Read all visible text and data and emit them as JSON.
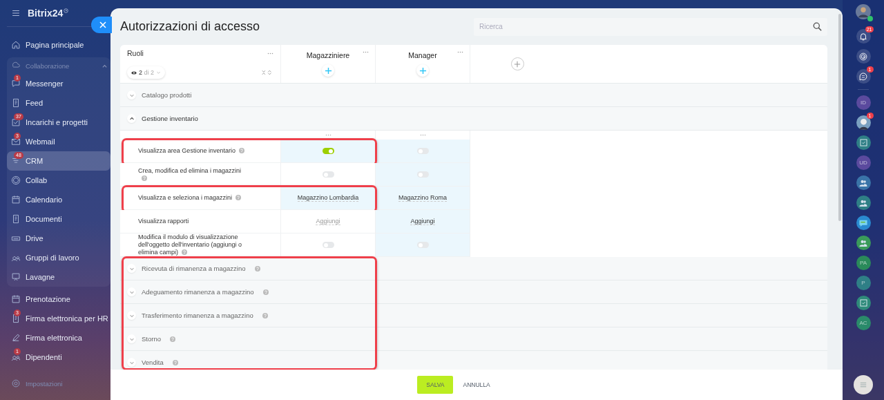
{
  "sidebar": {
    "logo": "Bitrix24",
    "items": [
      {
        "label": "Pagina principale",
        "selected": false
      },
      {
        "label": "Collaborazione",
        "kind": "group",
        "expanded": true,
        "children": [
          {
            "label": "Messenger",
            "badge": "1",
            "selected": false
          },
          {
            "label": "Feed",
            "selected": false
          },
          {
            "label": "Incarichi e progetti",
            "badge": "37",
            "selected": false
          },
          {
            "label": "Webmail",
            "badge": "3",
            "selected": false
          },
          {
            "label": "CRM",
            "badge": "48",
            "selected": true
          },
          {
            "label": "Collab",
            "selected": false
          },
          {
            "label": "Calendario",
            "selected": false
          },
          {
            "label": "Documenti",
            "selected": false
          },
          {
            "label": "Drive",
            "selected": false
          },
          {
            "label": "Gruppi di lavoro",
            "selected": false
          },
          {
            "label": "Lavagne",
            "selected": false
          }
        ]
      },
      {
        "label": "Prenotazione",
        "selected": false
      },
      {
        "label": "Firma elettronica per HR",
        "badge": "3",
        "selected": false
      },
      {
        "label": "Firma elettronica",
        "selected": false
      },
      {
        "label": "Dipendenti",
        "badge": "1",
        "selected": false
      }
    ],
    "settings": "Impostazioni"
  },
  "panel": {
    "title": "Autorizzazioni di accesso",
    "search": {
      "placeholder": "Ricerca"
    }
  },
  "table": {
    "roles_label": "Ruoli",
    "filter": "**2** di 2",
    "roles": [
      {
        "name": "Magazziniere"
      },
      {
        "name": "Manager"
      }
    ],
    "sections_before": [
      {
        "label": "Catalogo prodotti",
        "expanded": false
      },
      {
        "label": "Gestione inventario",
        "expanded": true
      }
    ],
    "permissions": [
      {
        "label": "Visualizza area Gestione inventario",
        "help": true,
        "highlighted": true,
        "cells": [
          {
            "kind": "toggle",
            "on": true,
            "tinted": true
          },
          {
            "kind": "toggle",
            "on": false,
            "tinted": true
          }
        ]
      },
      {
        "label": "Crea, modifica ed elimina i magazzini",
        "help": true,
        "highlighted": false,
        "cells": [
          {
            "kind": "toggle",
            "on": false,
            "tinted": false
          },
          {
            "kind": "toggle",
            "on": false,
            "tinted": true
          }
        ]
      },
      {
        "label": "Visualizza e seleziona i magazzini",
        "help": true,
        "highlighted": true,
        "cells": [
          {
            "kind": "link",
            "value": "Magazzino Lombardia",
            "tinted": true
          },
          {
            "kind": "link",
            "value": "Magazzino Roma",
            "tinted": true
          }
        ]
      },
      {
        "label": "Visualizza rapporti",
        "help": false,
        "highlighted": false,
        "cells": [
          {
            "kind": "link",
            "value": "Aggiungi",
            "tinted": false
          },
          {
            "kind": "link",
            "value": "Aggiungi",
            "tinted": true
          }
        ]
      },
      {
        "label": "Modifica il modulo di visualizzazione dell'oggetto dell'inventario (aggiungi o elimina campi)",
        "help": true,
        "highlighted": false,
        "cells": [
          {
            "kind": "toggle",
            "on": false,
            "tinted": false
          },
          {
            "kind": "toggle",
            "on": false,
            "tinted": true
          }
        ]
      }
    ],
    "collapsed_sections": {
      "highlighted": true,
      "items": [
        {
          "label": "Ricevuta di rimanenza a magazzino",
          "expanded": false
        },
        {
          "label": "Adeguamento rimanenza a magazzino",
          "expanded": false
        },
        {
          "label": "Trasferimento rimanenza a magazzino",
          "expanded": false
        },
        {
          "label": "Storno",
          "expanded": false
        },
        {
          "label": "Vendita",
          "expanded": false
        }
      ]
    }
  },
  "footer": {
    "save": "SALVA",
    "cancel": "ANNULLA"
  },
  "rightbar": {
    "top": [
      {
        "kind": "bell",
        "badge": "21"
      },
      {
        "kind": "swirl"
      },
      {
        "kind": "chat",
        "badge": "1"
      }
    ],
    "contacts": [
      {
        "kind": "initials",
        "text": "ID",
        "color": "#5b4a9e"
      },
      {
        "color": "#7aa0c0",
        "badge": "1"
      },
      {
        "kind": "task",
        "color": "#2f7f86"
      },
      {
        "kind": "initials",
        "text": "UD",
        "color": "#5b4a9e"
      },
      {
        "kind": "people",
        "color": "#3a74a8"
      },
      {
        "kind": "people",
        "color": "#2f7f86"
      },
      {
        "kind": "chat",
        "color": "#2a8ad0"
      },
      {
        "kind": "people",
        "color": "#3a9a5a"
      },
      {
        "kind": "initials",
        "text": "PA",
        "color": "#2a8a5a"
      },
      {
        "kind": "initials",
        "text": "P",
        "color": "#2f7f86"
      },
      {
        "kind": "task",
        "color": "#2f8a7a"
      },
      {
        "kind": "initials",
        "text": "AC",
        "color": "#2a8a6a"
      }
    ]
  }
}
